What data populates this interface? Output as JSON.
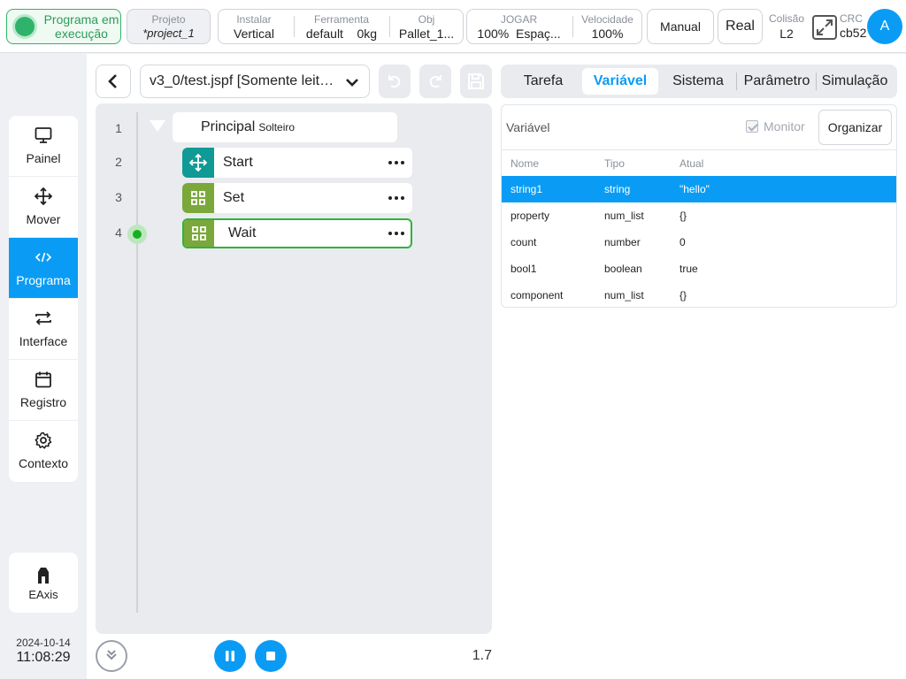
{
  "topbar": {
    "status": "Programa em execução",
    "project_caption": "Projeto",
    "project_value": "*project_1",
    "install_caption": "Instalar",
    "install_value": "Vertical",
    "tool_caption": "Ferramenta",
    "tool_value": "default",
    "tool_weight": "0kg",
    "obj_caption": "Obj",
    "obj_value": "Pallet_1...",
    "jog_caption": "JOGAR",
    "jog_value": "100%",
    "jog_space": "Espaç...",
    "speed_caption": "Velocidade",
    "speed_value": "100%",
    "manual_label": "Manual",
    "real_label": "Real",
    "collision_caption": "Colisão",
    "collision_value": "L2",
    "crc_caption": "CRC",
    "crc_value": "cb52",
    "avatar_initial": "A"
  },
  "sidebar": {
    "items": [
      {
        "label": "Painel",
        "icon": "monitor-icon"
      },
      {
        "label": "Mover",
        "icon": "move-arrows-icon"
      },
      {
        "label": "Programa",
        "icon": "code-icon",
        "active": true
      },
      {
        "label": "Interface",
        "icon": "swap-arrows-icon"
      },
      {
        "label": "Registro",
        "icon": "calendar-icon"
      },
      {
        "label": "Contexto",
        "icon": "gear-icon"
      }
    ],
    "eaxis_label": "EAxis",
    "date": "2024-10-14",
    "time": "11:08:29"
  },
  "editor": {
    "file_name": "v3_0/test.jspf [Somente leitura]",
    "root": {
      "line": "1",
      "label": "Principal",
      "sub": "Solteiro"
    },
    "nodes": [
      {
        "line": "2",
        "label": "Start",
        "icon": "move-arrows-icon",
        "color": "#0f9a95"
      },
      {
        "line": "3",
        "label": "Set",
        "icon": "grid-icon",
        "color": "#7ba83a"
      },
      {
        "line": "4",
        "label": "Wait",
        "icon": "grid-icon",
        "color": "#7ba83a",
        "selected": true,
        "running": true
      }
    ],
    "version": "1.7"
  },
  "tabs": [
    "Tarefa",
    "Variável",
    "Sistema",
    "Parâmetro",
    "Simulação"
  ],
  "active_tab": "Variável",
  "variables": {
    "title": "Variável",
    "monitor_label": "Monitor",
    "organize_label": "Organizar",
    "headers": {
      "name": "Nome",
      "type": "Tipo",
      "current": "Atual"
    },
    "rows": [
      {
        "name": "string1",
        "type": "string",
        "current": "\"hello\"",
        "selected": true
      },
      {
        "name": "property",
        "type": "num_list",
        "current": "{}"
      },
      {
        "name": "count",
        "type": "number",
        "current": "0"
      },
      {
        "name": "bool1",
        "type": "boolean",
        "current": "true"
      },
      {
        "name": "component",
        "type": "num_list",
        "current": "{}"
      }
    ]
  },
  "colors": {
    "accent": "#0a9cf5",
    "running_green": "#2fb36b",
    "node_teal": "#0f9a95",
    "node_olive": "#7ba83a"
  }
}
